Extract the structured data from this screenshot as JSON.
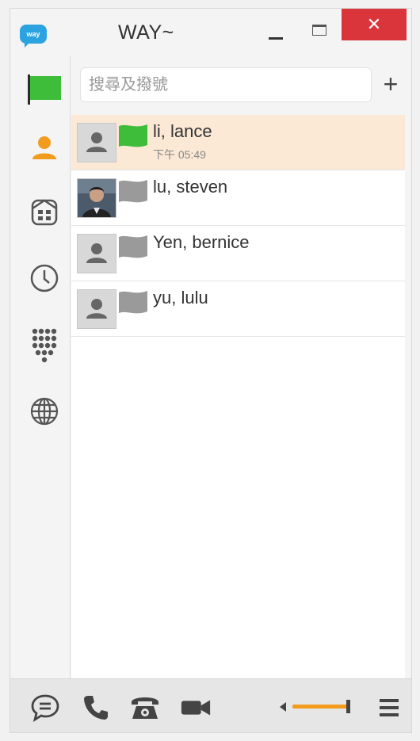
{
  "app": {
    "logo_text": "way",
    "title": "WAY~",
    "close_glyph": "✕"
  },
  "sidebar": {
    "items": [
      {
        "name": "flag-icon",
        "active": false
      },
      {
        "name": "contacts-icon",
        "active": true
      },
      {
        "name": "building-icon",
        "active": false
      },
      {
        "name": "clock-icon",
        "active": false
      },
      {
        "name": "dialpad-icon",
        "active": false
      },
      {
        "name": "globe-icon",
        "active": false
      }
    ]
  },
  "search": {
    "placeholder": "搜尋及撥號",
    "value": "",
    "add_label": "+"
  },
  "contacts": [
    {
      "name": "li, lance",
      "time": "下午 05:49",
      "status": "online",
      "selected": true,
      "avatar": "default"
    },
    {
      "name": "lu, steven",
      "time": "",
      "status": "offline",
      "selected": false,
      "avatar": "photo"
    },
    {
      "name": "Yen, bernice",
      "time": "",
      "status": "offline",
      "selected": false,
      "avatar": "default"
    },
    {
      "name": "yu, lulu",
      "time": "",
      "status": "offline",
      "selected": false,
      "avatar": "default"
    }
  ],
  "toolbar": {
    "items": [
      "chat-icon",
      "phone-icon",
      "desk-phone-icon",
      "video-icon",
      "volume-icon",
      "menu-icon"
    ],
    "volume_level": 0.9
  },
  "colors": {
    "accent": "#f29b1c",
    "online_flag": "#3dbd3a",
    "offline_flag": "#9a9a9a",
    "close": "#d9353a",
    "selected_row": "#fbe9d6",
    "logo": "#2aa3e0"
  }
}
